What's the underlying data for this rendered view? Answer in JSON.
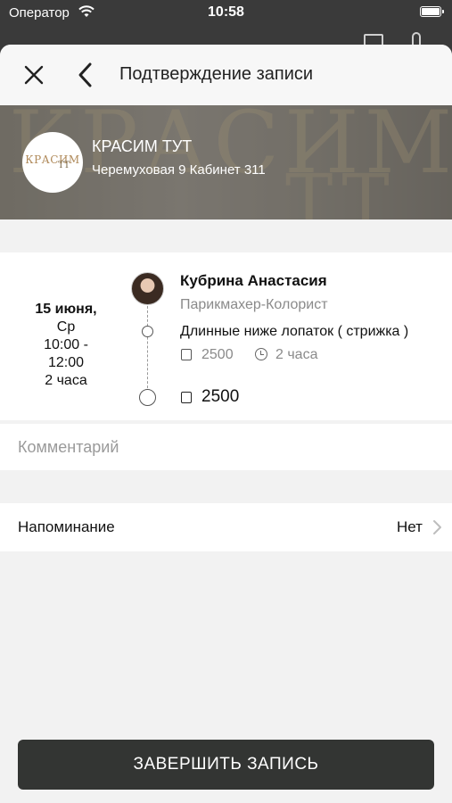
{
  "status_bar": {
    "carrier": "Оператор",
    "time": "10:58"
  },
  "nav": {
    "title": "Подтверждение записи"
  },
  "salon": {
    "name": "КРАСИМ ТУТ",
    "address": "Черемуховая 9 Кабинет 311",
    "logo_text": "КРАСИМ",
    "logo_sub": "ТТ"
  },
  "appointment": {
    "date": "15 июня,",
    "weekday": "Ср",
    "time_start": "10:00 -",
    "time_end": "12:00",
    "duration": "2 часа",
    "master": {
      "name": "Кубрина Анастасия",
      "role": "Парикмахер-Колорист"
    },
    "service": {
      "name": "Длинные ниже лопаток ( стрижка )",
      "price": "2500",
      "duration": "2 часа"
    },
    "total": "2500"
  },
  "comment": {
    "placeholder": "Комментарий",
    "value": ""
  },
  "reminder": {
    "label": "Напоминание",
    "value": "Нет"
  },
  "finish_button": {
    "label": "ЗАВЕРШИТЬ ЗАПИСЬ"
  },
  "colors": {
    "button_bg": "#333533",
    "sheet_bg": "#f2f2f2"
  }
}
